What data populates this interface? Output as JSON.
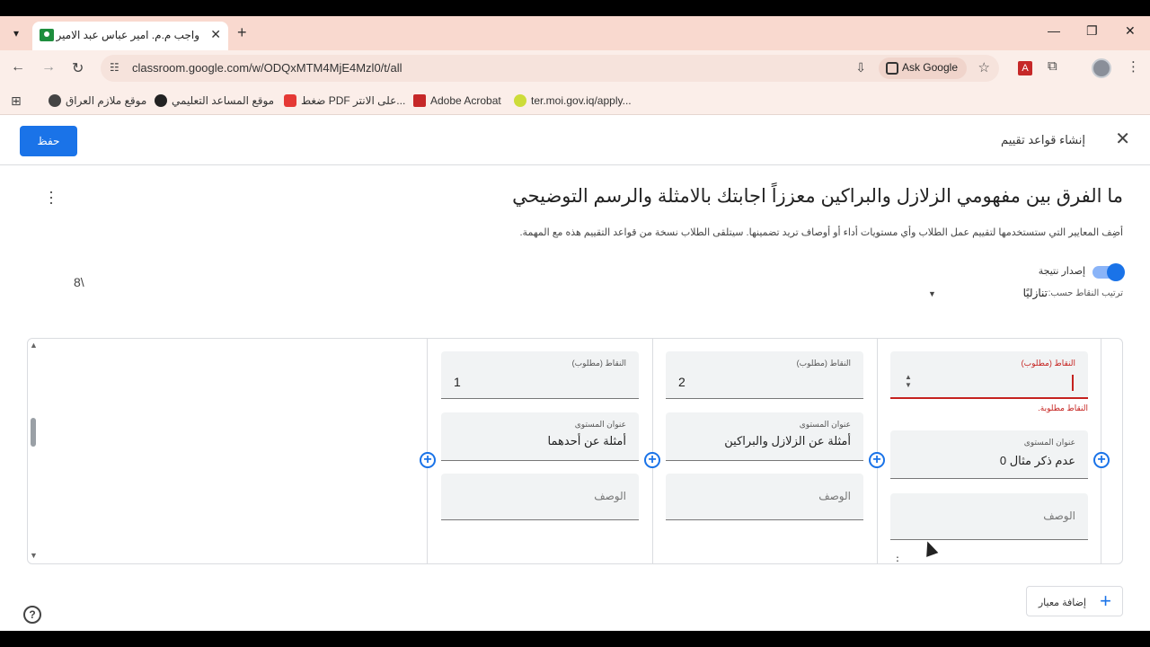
{
  "browser": {
    "tab_title": "واجب م.م. امير عباس عبد الامير",
    "url": "classroom.google.com/w/ODQxMTM4MjE4Mzl0/t/all",
    "ask_google": "Ask Google",
    "bookmarks": [
      "موقع ملازم العراق",
      "موقع المساعد التعليمي",
      "ضغط PDF على الانتر...",
      "Adobe Acrobat",
      "ter.moi.gov.iq/apply..."
    ]
  },
  "header": {
    "save_label": "حفظ",
    "title": "إنشاء قواعد تقييم"
  },
  "criterion": {
    "title": "ما الفرق بين مفهومي الزلازل والبراكين معززاً اجابتك بالامثلة والرسم التوضيحي",
    "description": "أضِف المعايير التي ستستخدمها لتقييم عمل الطلاب وأي مستويات أداء أو أوصاف تريد تضمينها. سيتلقى الطلاب نسخة من قواعد التقييم هذه مع المهمة.",
    "score": "8\\",
    "scoring_toggle_label": "إصدار نتيجة",
    "scoring_toggle_on": true,
    "sort_label": "ترتيب النقاط حسب:",
    "sort_value": "تنازليًا",
    "levels": [
      {
        "points_label": "النقاط (مطلوب)",
        "points": "",
        "error": "النقاط مطلوبة.",
        "title_label": "عنوان المستوى",
        "title": "عدم ذكر مثال 0",
        "description_placeholder": "الوصف"
      },
      {
        "points_label": "النقاط (مطلوب)",
        "points": "2",
        "title_label": "عنوان المستوى",
        "title": "أمثلة عن الزلازل والبراكين",
        "description_placeholder": "الوصف"
      },
      {
        "points_label": "النقاط (مطلوب)",
        "points": "1",
        "title_label": "عنوان المستوى",
        "title": "أمثلة عن أحدهما",
        "description_placeholder": "الوصف"
      }
    ]
  },
  "add_criterion_label": "إضافة معيار",
  "colors": {
    "accent": "#1a73e8",
    "error": "#c5221f",
    "tab_strip": "#f9d9cf"
  }
}
